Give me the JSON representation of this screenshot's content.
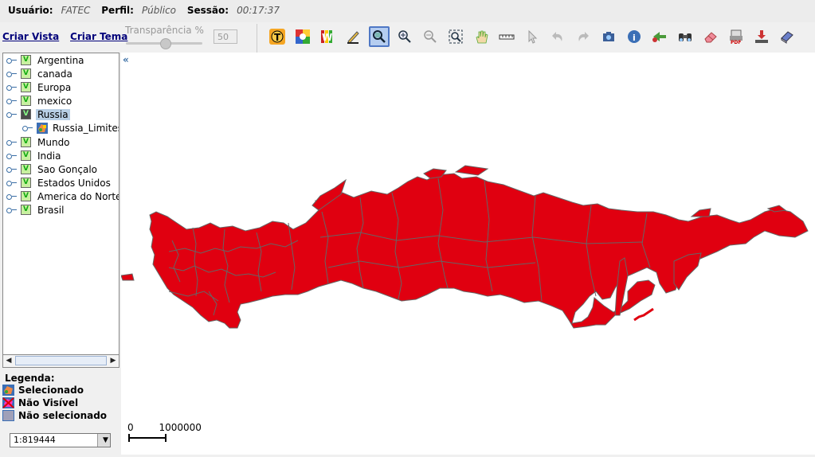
{
  "session": {
    "user_label": "Usuário:",
    "user_value": "FATEC",
    "profile_label": "Perfil:",
    "profile_value": "Público",
    "session_label": "Sessão:",
    "session_value": "00:17:37"
  },
  "links": {
    "create_view": "Criar Vista",
    "create_theme": "Criar Tema"
  },
  "transparency": {
    "label": "Transparência %",
    "value": "50"
  },
  "toolbar": [
    {
      "name": "theme-tool-icon"
    },
    {
      "name": "google-icon"
    },
    {
      "name": "wms-icon"
    },
    {
      "name": "pencil-icon"
    },
    {
      "name": "zoom-select-icon",
      "active": true
    },
    {
      "name": "zoom-in-icon"
    },
    {
      "name": "zoom-out-icon"
    },
    {
      "name": "zoom-extent-icon"
    },
    {
      "name": "pan-hand-icon"
    },
    {
      "name": "measure-ruler-icon"
    },
    {
      "name": "pointer-icon"
    },
    {
      "name": "undo-icon"
    },
    {
      "name": "redo-icon"
    },
    {
      "name": "camera-icon"
    },
    {
      "name": "info-icon"
    },
    {
      "name": "route-icon"
    },
    {
      "name": "binoculars-icon"
    },
    {
      "name": "eraser-icon"
    },
    {
      "name": "pdf-print-icon"
    },
    {
      "name": "download-icon"
    },
    {
      "name": "book-icon"
    }
  ],
  "tree": {
    "themes": [
      {
        "label": "Argentina"
      },
      {
        "label": "canada"
      },
      {
        "label": "Europa"
      },
      {
        "label": "mexico"
      },
      {
        "label": "Russia",
        "selected": true
      },
      {
        "label": "Russia_Limites",
        "child": true
      },
      {
        "label": "Mundo"
      },
      {
        "label": "India"
      },
      {
        "label": "Sao Gonçalo"
      },
      {
        "label": "Estados Unidos"
      },
      {
        "label": "America do Norte"
      },
      {
        "label": "Brasil"
      }
    ]
  },
  "legend": {
    "title": "Legenda:",
    "items": [
      "Selecionado",
      "Não Visível",
      "Não selecionado"
    ]
  },
  "scale": {
    "value": "1:819444",
    "bar_start": "0",
    "bar_end": "1000000"
  },
  "map": {
    "fill_color": "#e00010",
    "border_color": "#666666"
  }
}
